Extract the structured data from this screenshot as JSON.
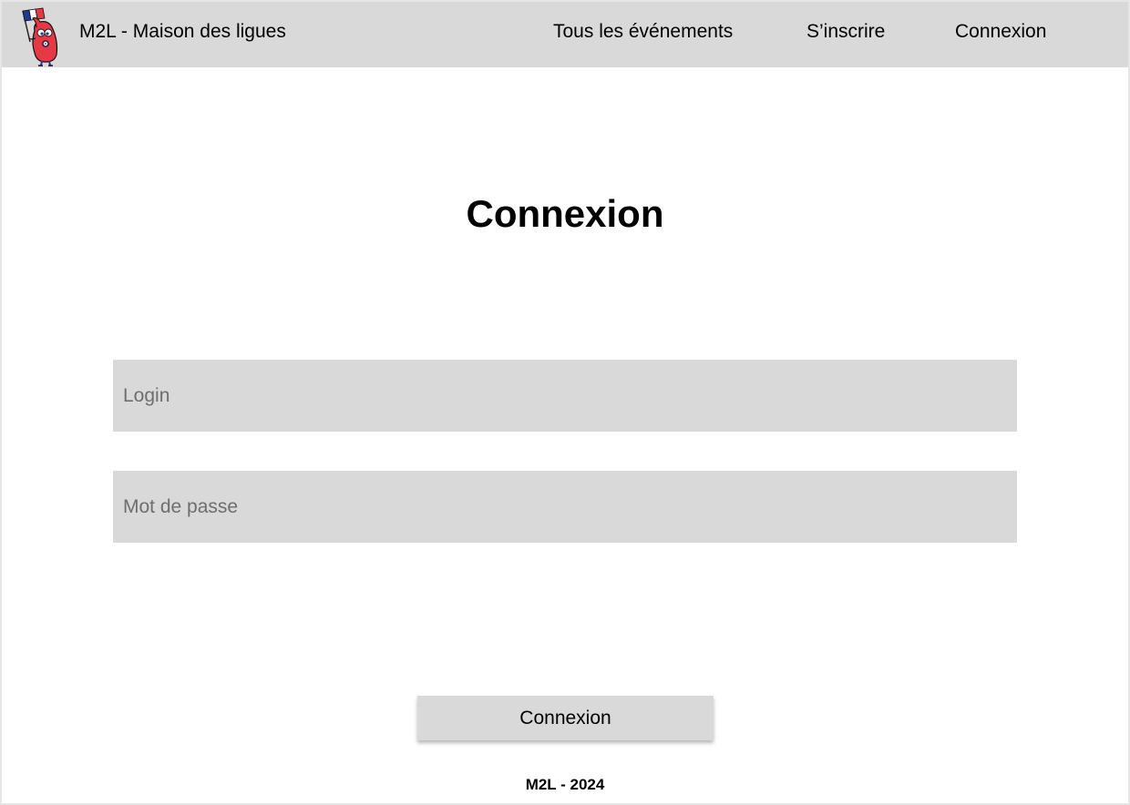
{
  "header": {
    "brand": "M2L - Maison des ligues",
    "logo_icon": "mascot-flag-icon",
    "nav": {
      "events": "Tous les événements",
      "register": "S’inscrire",
      "login": "Connexion"
    }
  },
  "main": {
    "title": "Connexion",
    "login_field": {
      "placeholder": "Login",
      "value": ""
    },
    "password_field": {
      "placeholder": "Mot de passe",
      "value": ""
    },
    "submit_label": "Connexion"
  },
  "footer": {
    "text": "M2L - 2024"
  },
  "colors": {
    "navbar_bg": "#d9d9d9",
    "field_bg": "#d9d9d9",
    "button_bg": "#d9d9d9",
    "page_bg": "#ffffff",
    "text": "#000000",
    "placeholder": "#6e6e6e"
  }
}
